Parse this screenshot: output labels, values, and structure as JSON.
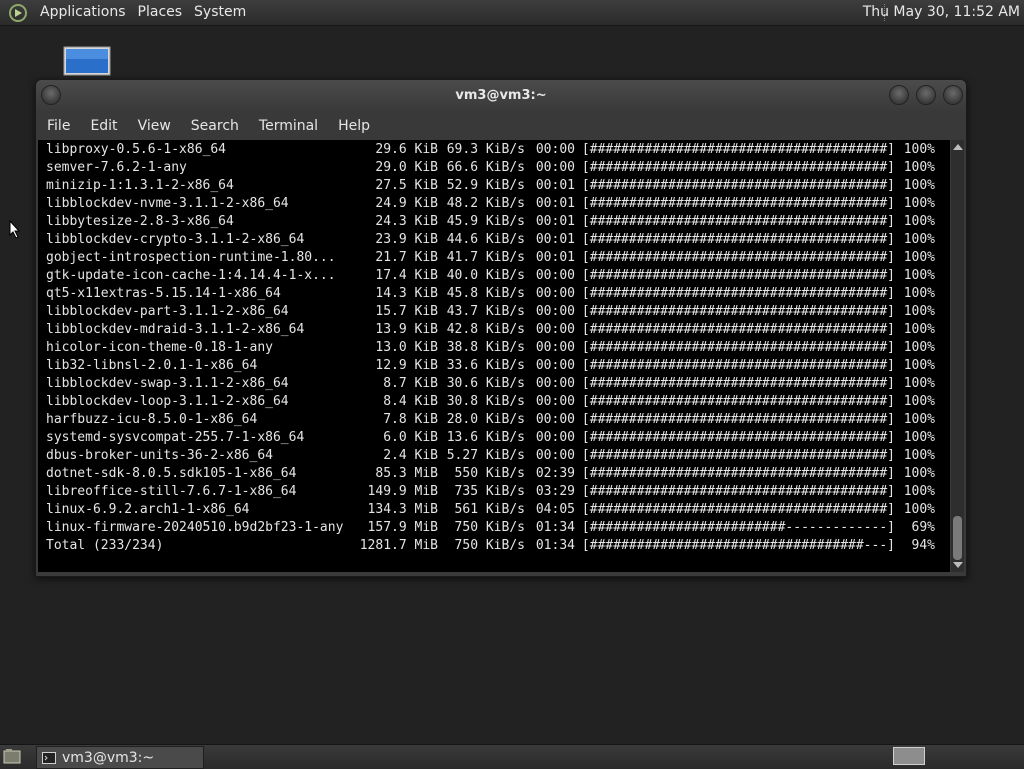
{
  "top_panel": {
    "menus": [
      "Applications",
      "Places",
      "System"
    ],
    "clock": "Thu May 30, 11:52 AM"
  },
  "window": {
    "title": "vm3@vm3:~",
    "menu": [
      "File",
      "Edit",
      "View",
      "Search",
      "Terminal",
      "Help"
    ]
  },
  "terminal": {
    "rows": [
      {
        "pkg": "libproxy-0.5.6-1-x86_64",
        "size": "29.6 KiB",
        "rate": "69.3 KiB/s",
        "eta": "00:00",
        "bar": "[######################################]",
        "pct": "100%"
      },
      {
        "pkg": "semver-7.6.2-1-any",
        "size": "29.0 KiB",
        "rate": "66.6 KiB/s",
        "eta": "00:00",
        "bar": "[######################################]",
        "pct": "100%"
      },
      {
        "pkg": "minizip-1:1.3.1-2-x86_64",
        "size": "27.5 KiB",
        "rate": "52.9 KiB/s",
        "eta": "00:01",
        "bar": "[######################################]",
        "pct": "100%"
      },
      {
        "pkg": "libblockdev-nvme-3.1.1-2-x86_64",
        "size": "24.9 KiB",
        "rate": "48.2 KiB/s",
        "eta": "00:01",
        "bar": "[######################################]",
        "pct": "100%"
      },
      {
        "pkg": "libbytesize-2.8-3-x86_64",
        "size": "24.3 KiB",
        "rate": "45.9 KiB/s",
        "eta": "00:01",
        "bar": "[######################################]",
        "pct": "100%"
      },
      {
        "pkg": "libblockdev-crypto-3.1.1-2-x86_64",
        "size": "23.9 KiB",
        "rate": "44.6 KiB/s",
        "eta": "00:01",
        "bar": "[######################################]",
        "pct": "100%"
      },
      {
        "pkg": "gobject-introspection-runtime-1.80...",
        "size": "21.7 KiB",
        "rate": "41.7 KiB/s",
        "eta": "00:01",
        "bar": "[######################################]",
        "pct": "100%"
      },
      {
        "pkg": "gtk-update-icon-cache-1:4.14.4-1-x...",
        "size": "17.4 KiB",
        "rate": "40.0 KiB/s",
        "eta": "00:00",
        "bar": "[######################################]",
        "pct": "100%"
      },
      {
        "pkg": "qt5-x11extras-5.15.14-1-x86_64",
        "size": "14.3 KiB",
        "rate": "45.8 KiB/s",
        "eta": "00:00",
        "bar": "[######################################]",
        "pct": "100%"
      },
      {
        "pkg": "libblockdev-part-3.1.1-2-x86_64",
        "size": "15.7 KiB",
        "rate": "43.7 KiB/s",
        "eta": "00:00",
        "bar": "[######################################]",
        "pct": "100%"
      },
      {
        "pkg": "libblockdev-mdraid-3.1.1-2-x86_64",
        "size": "13.9 KiB",
        "rate": "42.8 KiB/s",
        "eta": "00:00",
        "bar": "[######################################]",
        "pct": "100%"
      },
      {
        "pkg": "hicolor-icon-theme-0.18-1-any",
        "size": "13.0 KiB",
        "rate": "38.8 KiB/s",
        "eta": "00:00",
        "bar": "[######################################]",
        "pct": "100%"
      },
      {
        "pkg": "lib32-libnsl-2.0.1-1-x86_64",
        "size": "12.9 KiB",
        "rate": "33.6 KiB/s",
        "eta": "00:00",
        "bar": "[######################################]",
        "pct": "100%"
      },
      {
        "pkg": "libblockdev-swap-3.1.1-2-x86_64",
        "size": "8.7 KiB",
        "rate": "30.6 KiB/s",
        "eta": "00:00",
        "bar": "[######################################]",
        "pct": "100%"
      },
      {
        "pkg": "libblockdev-loop-3.1.1-2-x86_64",
        "size": "8.4 KiB",
        "rate": "30.8 KiB/s",
        "eta": "00:00",
        "bar": "[######################################]",
        "pct": "100%"
      },
      {
        "pkg": "harfbuzz-icu-8.5.0-1-x86_64",
        "size": "7.8 KiB",
        "rate": "28.0 KiB/s",
        "eta": "00:00",
        "bar": "[######################################]",
        "pct": "100%"
      },
      {
        "pkg": "systemd-sysvcompat-255.7-1-x86_64",
        "size": "6.0 KiB",
        "rate": "13.6 KiB/s",
        "eta": "00:00",
        "bar": "[######################################]",
        "pct": "100%"
      },
      {
        "pkg": "dbus-broker-units-36-2-x86_64",
        "size": "2.4 KiB",
        "rate": "5.27 KiB/s",
        "eta": "00:00",
        "bar": "[######################################]",
        "pct": "100%"
      },
      {
        "pkg": "dotnet-sdk-8.0.5.sdk105-1-x86_64",
        "size": "85.3 MiB",
        "rate": "550 KiB/s",
        "eta": "02:39",
        "bar": "[######################################]",
        "pct": "100%"
      },
      {
        "pkg": "libreoffice-still-7.6.7-1-x86_64",
        "size": "149.9 MiB",
        "rate": "735 KiB/s",
        "eta": "03:29",
        "bar": "[######################################]",
        "pct": "100%"
      },
      {
        "pkg": "linux-6.9.2.arch1-1-x86_64",
        "size": "134.3 MiB",
        "rate": "561 KiB/s",
        "eta": "04:05",
        "bar": "[######################################]",
        "pct": "100%"
      },
      {
        "pkg": "linux-firmware-20240510.b9d2bf23-1-any",
        "size": "157.9 MiB",
        "rate": "750 KiB/s",
        "eta": "01:34",
        "bar": "[#########################-------------]",
        "pct": "69%"
      },
      {
        "pkg": "Total (233/234)",
        "size": "1281.7 MiB",
        "rate": "750 KiB/s",
        "eta": "01:34",
        "bar": "[###################################---]",
        "pct": "94%"
      }
    ]
  },
  "taskbar": {
    "task_label": "vm3@vm3:~"
  },
  "colors": {
    "terminal_bg": "#000000",
    "terminal_fg": "#e5e5e5",
    "panel_bg": "#2f2f2f",
    "desktop_bg": "#222222"
  }
}
